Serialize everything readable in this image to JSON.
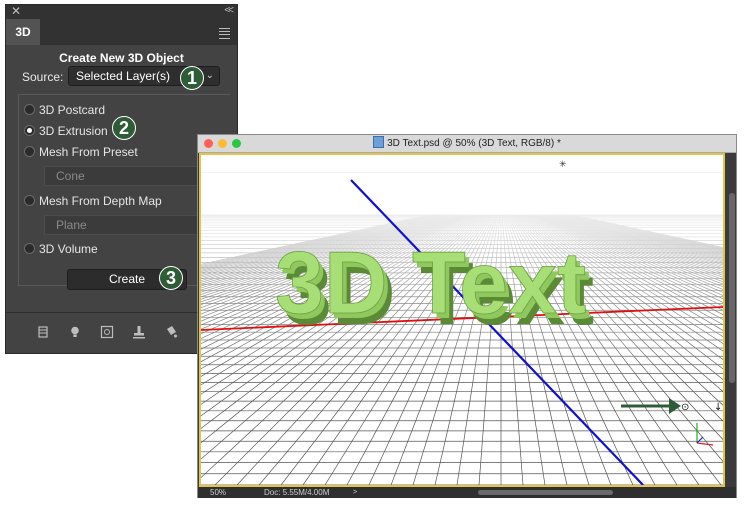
{
  "panel": {
    "close_glyph": "✕",
    "collapse_glyph": "<<",
    "tab": "3D",
    "heading": "Create New 3D Object",
    "source_label": "Source:",
    "source_value": "Selected Layer(s)",
    "options": [
      "3D Postcard",
      "3D Extrusion",
      "Mesh From Preset",
      "Mesh From Depth Map",
      "3D Volume"
    ],
    "selected_option": "3D Extrusion",
    "preset_value": "Cone",
    "depth_map_value": "Plane",
    "create_label": "Create",
    "bottom_icons": [
      "environment-icon",
      "light-bulb-icon",
      "camera-view-icon",
      "stamp-icon",
      "paint-bucket-icon"
    ]
  },
  "callouts": [
    "1",
    "2",
    "3"
  ],
  "document": {
    "title": "3D Text.psd @ 50% (3D Text, RGB/8) *",
    "scene_text": "3D Text",
    "zoom": "50%",
    "doc_info": "Doc: 5.55M/4.00M",
    "status_arrow": ">"
  },
  "colors": {
    "panel_bg": "#434343",
    "callout_green": "#2e5c36",
    "text_3d_face": "#9bd36a",
    "text_3d_side": "#5a8a36",
    "axis_red": "#e01010",
    "axis_blue": "#1010d0",
    "selection_border": "#e5c24a",
    "traffic_red": "#ff5f57",
    "traffic_yellow": "#febc2e",
    "traffic_green": "#28c840"
  }
}
